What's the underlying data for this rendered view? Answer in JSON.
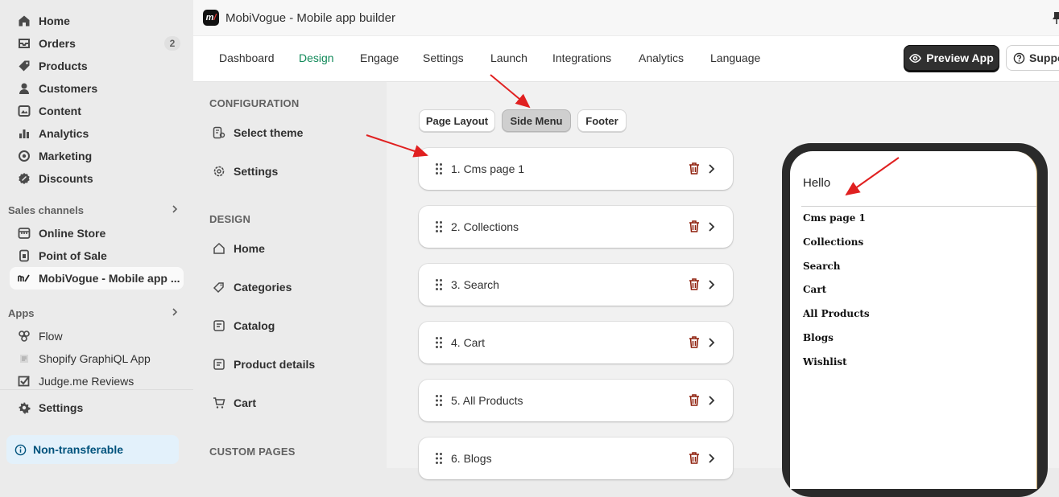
{
  "sidebar": {
    "items": [
      {
        "label": "Home",
        "icon": "home-icon"
      },
      {
        "label": "Orders",
        "icon": "orders-icon",
        "badge": "2"
      },
      {
        "label": "Products",
        "icon": "tag-icon"
      },
      {
        "label": "Customers",
        "icon": "person-icon"
      },
      {
        "label": "Content",
        "icon": "content-icon"
      },
      {
        "label": "Analytics",
        "icon": "bar-chart-icon"
      },
      {
        "label": "Marketing",
        "icon": "target-icon"
      },
      {
        "label": "Discounts",
        "icon": "discount-icon"
      }
    ],
    "sales_channels": {
      "label": "Sales channels",
      "items": [
        {
          "label": "Online Store",
          "icon": "store-icon"
        },
        {
          "label": "Point of Sale",
          "icon": "pos-icon"
        },
        {
          "label": "MobiVogue - Mobile app ...",
          "icon": "mobivogue-icon"
        }
      ]
    },
    "apps": {
      "label": "Apps",
      "items": [
        {
          "label": "Flow",
          "icon": "flow-icon"
        },
        {
          "label": "Shopify GraphiQL App",
          "icon": "graphiql-icon"
        },
        {
          "label": "Judge.me Reviews",
          "icon": "judgeme-icon"
        }
      ]
    },
    "settings_label": "Settings",
    "non_transferable": "Non-transferable"
  },
  "header": {
    "logo_text": "m",
    "title": "MobiVogue - Mobile app builder"
  },
  "topnav": {
    "tabs": [
      "Dashboard",
      "Design",
      "Engage",
      "Settings",
      "Launch",
      "Integrations",
      "Analytics",
      "Language"
    ],
    "active_tab": "Design",
    "preview_label": "Preview App",
    "support_label": "Support"
  },
  "config": {
    "configuration_heading": "CONFIGURATION",
    "configuration_items": [
      "Select theme",
      "Settings"
    ],
    "design_heading": "DESIGN",
    "design_items": [
      "Home",
      "Categories",
      "Catalog",
      "Product details",
      "Cart"
    ],
    "custom_pages_heading": "CUSTOM PAGES"
  },
  "main": {
    "segments": [
      "Page Layout",
      "Side Menu",
      "Footer"
    ],
    "active_segment": "Side Menu",
    "menu_items": [
      "1. Cms page 1",
      "2. Collections",
      "3. Search",
      "4. Cart",
      "5. All Products",
      "6. Blogs"
    ]
  },
  "phone": {
    "greeting": "Hello",
    "menu": [
      "Cms page 1",
      "Collections",
      "Search",
      "Cart",
      "All Products",
      "Blogs",
      "Wishlist"
    ]
  },
  "colors": {
    "active_tab": "#128a5a",
    "trash": "#8e1f0b",
    "annotation_arrow": "#e02020",
    "info_banner_bg": "#e3f1fb"
  }
}
